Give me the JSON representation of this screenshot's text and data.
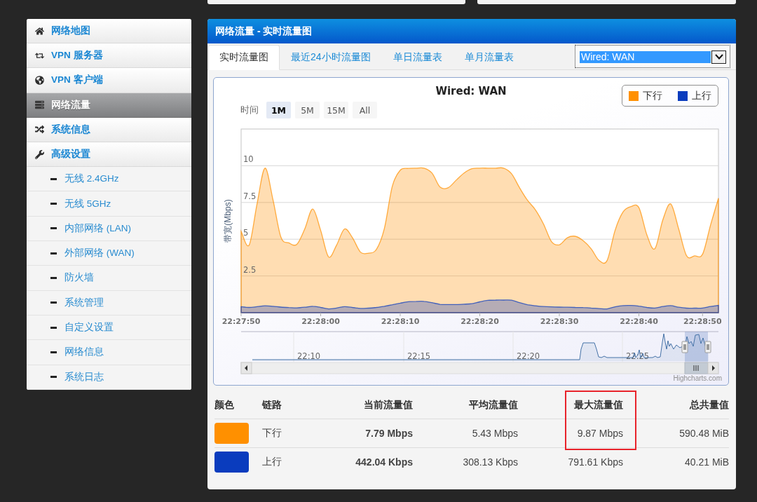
{
  "sidebar": {
    "items": [
      {
        "label": "网络地图",
        "selected": false
      },
      {
        "label": "VPN 服务器",
        "selected": false
      },
      {
        "label": "VPN 客户端",
        "selected": false
      },
      {
        "label": "网络流量",
        "selected": true
      },
      {
        "label": "系统信息",
        "selected": false
      },
      {
        "label": "高级设置",
        "selected": false,
        "children": [
          {
            "label": "无线 2.4GHz",
            "selected": false
          },
          {
            "label": "无线 5GHz",
            "selected": false
          },
          {
            "label": "内部网络 (LAN)",
            "selected": false
          },
          {
            "label": "外部网络 (WAN)",
            "selected": false
          },
          {
            "label": "防火墙",
            "selected": false
          },
          {
            "label": "系统管理",
            "selected": false
          },
          {
            "label": "自定义设置",
            "selected": false
          },
          {
            "label": "网络信息",
            "selected": false
          },
          {
            "label": "系统日志",
            "selected": false
          }
        ]
      }
    ]
  },
  "panel": {
    "title": "网络流量 - 实时流量图",
    "tabs": [
      {
        "label": "实时流量图",
        "selected": true
      },
      {
        "label": "最近24小时流量图",
        "selected": false
      },
      {
        "label": "单日流量表",
        "selected": false
      },
      {
        "label": "单月流量表",
        "selected": false
      }
    ],
    "interface_select": {
      "value": "Wired: WAN"
    }
  },
  "chart": {
    "range_label": "时间",
    "range_buttons": [
      {
        "label": "1M",
        "selected": true
      },
      {
        "label": "5M",
        "selected": false
      },
      {
        "label": "15M",
        "selected": false
      },
      {
        "label": "All",
        "selected": false
      }
    ],
    "chart_data": [
      {
        "type": "area",
        "title": "Wired: WAN",
        "ylabel": "带宽(Mbps)",
        "legend": "top-right",
        "grid": true,
        "ylim": [
          0,
          12.5
        ],
        "yticks": [
          2.5,
          5,
          7.5,
          10
        ],
        "categories": [
          "22:27:50",
          null,
          null,
          null,
          null,
          null,
          null,
          null,
          null,
          null,
          "22:28:00",
          null,
          null,
          null,
          null,
          null,
          null,
          null,
          null,
          null,
          "22:28:10",
          null,
          null,
          null,
          null,
          null,
          null,
          null,
          null,
          null,
          "22:28:20",
          null,
          null,
          null,
          null,
          null,
          null,
          null,
          null,
          null,
          "22:28:30",
          null,
          null,
          null,
          null,
          null,
          null,
          null,
          null,
          null,
          "22:28:40",
          null,
          null,
          null,
          null,
          null,
          null,
          null,
          "22:28:50",
          null,
          null
        ],
        "series": [
          {
            "name": "下行",
            "color": "#ff9000",
            "values": [
              5.55,
              4.6,
              7.4,
              9.84,
              7.7,
              5.14,
              4.75,
              4.65,
              5.7,
              7.05,
              5.6,
              3.8,
              4.6,
              5.7,
              5.1,
              4.12,
              4.05,
              4.3,
              5.72,
              8.6,
              9.7,
              9.82,
              9.84,
              9.84,
              9.5,
              8.55,
              8.5,
              9.0,
              9.5,
              9.8,
              9.84,
              9.84,
              9.84,
              9.84,
              9.45,
              8.5,
              7.65,
              7.0,
              6.05,
              4.85,
              4.62,
              5.1,
              5.2,
              4.9,
              4.35,
              3.55,
              3.55,
              5.6,
              6.85,
              7.22,
              7.15,
              5.3,
              4.35,
              6.3,
              7.4,
              5.7,
              3.87,
              3.87,
              3.98,
              5.95,
              7.79
            ]
          },
          {
            "name": "上行",
            "color": "#0a3cbe",
            "values": [
              0.41,
              0.36,
              0.41,
              0.47,
              0.44,
              0.38,
              0.35,
              0.33,
              0.37,
              0.44,
              0.36,
              0.26,
              0.32,
              0.41,
              0.36,
              0.29,
              0.31,
              0.36,
              0.44,
              0.54,
              0.65,
              0.75,
              0.77,
              0.77,
              0.68,
              0.57,
              0.56,
              0.56,
              0.58,
              0.61,
              0.74,
              0.84,
              0.86,
              0.86,
              0.85,
              0.68,
              0.54,
              0.47,
              0.42,
              0.4,
              0.38,
              0.37,
              0.36,
              0.35,
              0.32,
              0.28,
              0.26,
              0.4,
              0.48,
              0.49,
              0.45,
              0.36,
              0.32,
              0.42,
              0.48,
              0.37,
              0.31,
              0.31,
              0.32,
              0.42,
              0.5
            ]
          }
        ]
      }
    ],
    "navigator": {
      "labels": [
        "22:10",
        "22:15",
        "22:20",
        "22:25"
      ]
    },
    "credits": "Highcharts.com"
  },
  "table": {
    "columns": [
      {
        "label": "颜色",
        "highlighted": false
      },
      {
        "label": "链路",
        "highlighted": false
      },
      {
        "label": "当前流量值",
        "highlighted": false
      },
      {
        "label": "平均流量值",
        "highlighted": false
      },
      {
        "label": "最大流量值",
        "highlighted": true
      },
      {
        "label": "总共量值",
        "highlighted": false
      }
    ],
    "rows": [
      {
        "cells": [
          {
            "kind": "swatch",
            "color": "#ff9000"
          },
          {
            "kind": "text",
            "text": "下行"
          },
          {
            "kind": "text",
            "text": "7.79 Mbps"
          },
          {
            "kind": "text",
            "text": "5.43 Mbps"
          },
          {
            "kind": "text",
            "text": "9.87 Mbps"
          },
          {
            "kind": "text",
            "text": "590.48 MiB"
          }
        ]
      },
      {
        "cells": [
          {
            "kind": "swatch",
            "color": "#0a3cbe"
          },
          {
            "kind": "text",
            "text": "上行"
          },
          {
            "kind": "text",
            "text": "442.04 Kbps"
          },
          {
            "kind": "text",
            "text": "308.13 Kbps"
          },
          {
            "kind": "text",
            "text": "791.61 Kbps"
          },
          {
            "kind": "text",
            "text": "40.21 MiB"
          }
        ]
      }
    ]
  }
}
